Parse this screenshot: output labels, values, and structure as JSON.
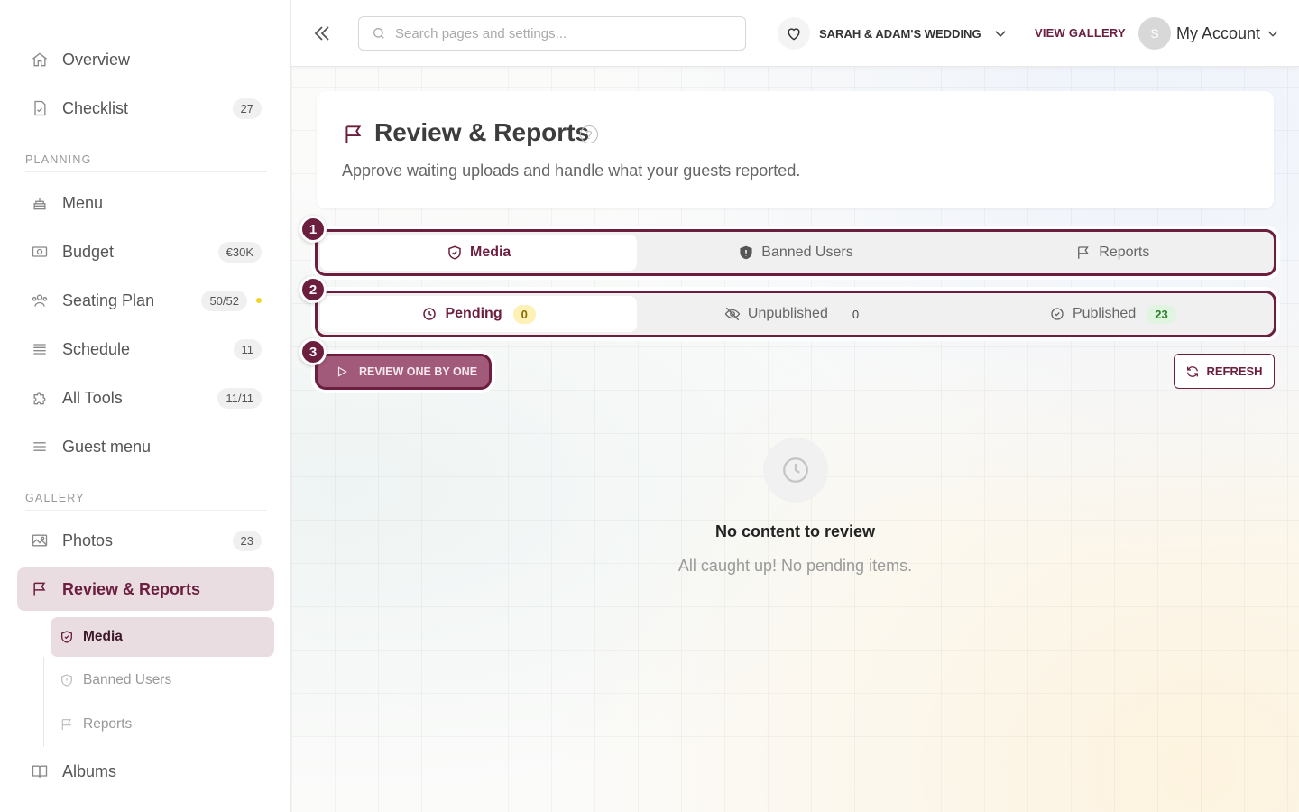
{
  "sidebar": {
    "items": [
      {
        "label": "Overview"
      },
      {
        "label": "Checklist",
        "badge": "27"
      },
      {
        "label": "Menu"
      },
      {
        "label": "Budget",
        "badge": "€30K"
      },
      {
        "label": "Seating Plan",
        "badge": "50/52"
      },
      {
        "label": "Schedule",
        "badge": "11"
      },
      {
        "label": "All Tools",
        "badge": "11/11"
      },
      {
        "label": "Guest menu"
      },
      {
        "label": "Photos",
        "badge": "23"
      },
      {
        "label": "Review & Reports"
      },
      {
        "label": "Albums"
      }
    ],
    "sections": {
      "planning": "PLANNING",
      "gallery": "GALLERY"
    },
    "subitems": [
      {
        "label": "Media"
      },
      {
        "label": "Banned Users"
      },
      {
        "label": "Reports"
      }
    ]
  },
  "topbar": {
    "search_placeholder": "Search pages and settings...",
    "event_name": "SARAH & ADAM'S WEDDING",
    "view_gallery": "VIEW GALLERY",
    "avatar_initial": "S",
    "account_label": "My Account"
  },
  "page": {
    "title": "Review & Reports",
    "help": "?",
    "subtitle": "Approve waiting uploads and handle what your guests reported."
  },
  "tabs": [
    {
      "label": "Media"
    },
    {
      "label": "Banned Users"
    },
    {
      "label": "Reports"
    }
  ],
  "status_tabs": [
    {
      "label": "Pending",
      "count": "0"
    },
    {
      "label": "Unpublished",
      "count": "0"
    },
    {
      "label": "Published",
      "count": "23"
    }
  ],
  "steps": [
    "1",
    "2",
    "3"
  ],
  "actions": {
    "review_one_by_one": "REVIEW ONE BY ONE",
    "refresh": "REFRESH"
  },
  "empty_state": {
    "title": "No content to review",
    "subtitle": "All caught up! No pending items."
  },
  "colors": {
    "brand": "#6b1e3e",
    "active_bg": "#eadde2",
    "pending_badge": "#fdf1b8",
    "published_badge": "#dff5df"
  }
}
